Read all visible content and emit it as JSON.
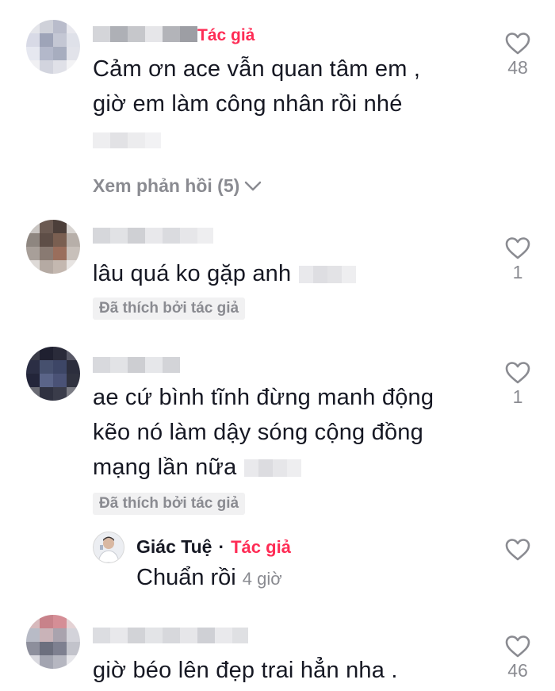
{
  "comments": [
    {
      "author_tag": "Tác giả",
      "text_lines": [
        "Cảm ơn ace vẫn quan tâm em ,",
        "giờ em làm công nhân rồi nhé"
      ],
      "likes": "48",
      "see_replies": "Xem phản hồi (5)"
    },
    {
      "text": "lâu quá ko gặp anh",
      "liked_by_author": "Đã thích bởi tác giả",
      "likes": "1"
    },
    {
      "text_lines": [
        "ae cứ bình tĩnh đừng manh động",
        "kẽo nó làm dậy sóng cộng đồng",
        "mạng lần nữa"
      ],
      "liked_by_author": "Đã thích bởi tác giả",
      "likes": "1",
      "reply": {
        "name": "Giác Tuệ",
        "separator": "·",
        "author_tag": "Tác giả",
        "text": "Chuẩn rồi",
        "time": "4 giờ"
      }
    },
    {
      "text": "giờ béo lên đẹp trai hẳn nha .",
      "likes": "46"
    }
  ],
  "colors": {
    "accent": "#fe2c55",
    "muted": "#8a8b91",
    "text": "#161823"
  },
  "icons": {
    "like": "heart-outline-icon",
    "expand": "chevron-down-icon"
  }
}
